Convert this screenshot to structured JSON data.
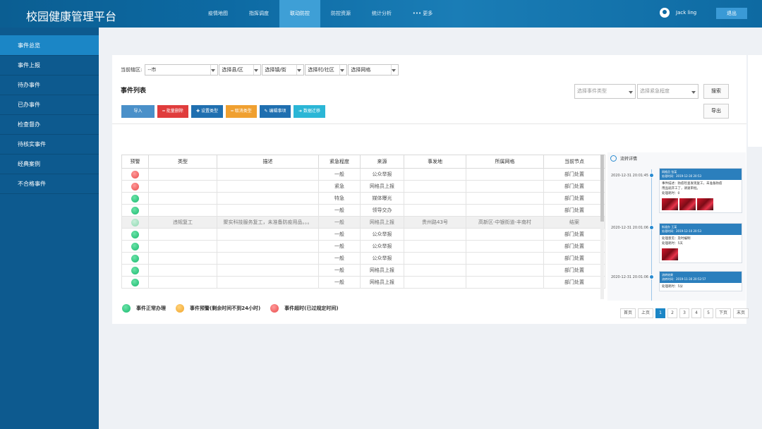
{
  "app": {
    "title": "校园健康管理平台"
  },
  "nav": [
    {
      "label": "疫情地图",
      "active": false
    },
    {
      "label": "指挥调度",
      "active": false
    },
    {
      "label": "联动防控",
      "active": true
    },
    {
      "label": "防控资源",
      "active": false
    },
    {
      "label": "统计分析",
      "active": false
    },
    {
      "label": "••• 更多",
      "active": false
    }
  ],
  "user": {
    "name": "Jack ling",
    "logout": "退出"
  },
  "sidebar": {
    "items": [
      {
        "label": "事件总览",
        "active": true
      },
      {
        "label": "事件上报"
      },
      {
        "label": "待办事件"
      },
      {
        "label": "已办事件"
      },
      {
        "label": "检查督办"
      },
      {
        "label": "待核实事件"
      },
      {
        "label": "经典案例"
      },
      {
        "label": "不合格事件"
      }
    ]
  },
  "filters": {
    "label": "当前辖区:",
    "selects": [
      "--市",
      "选择县/区",
      "选择镇/街",
      "选择村/社区",
      "选择网格"
    ]
  },
  "list": {
    "title": "事件列表",
    "event_type_placeholder": "选择事件类型",
    "urgency_placeholder": "选择紧急程度",
    "search": "搜索",
    "export": "导出"
  },
  "actions": [
    {
      "label": "导入",
      "color": "#4a90c9"
    },
    {
      "label": "━ 批量删除",
      "color": "#e03c3c"
    },
    {
      "label": "✚ 设置类型",
      "color": "#1f6fb0"
    },
    {
      "label": "━ 取消类型",
      "color": "#f0a030"
    },
    {
      "label": "✎ 编辑事项",
      "color": "#1f6fb0"
    },
    {
      "label": "➜ 数据迁移",
      "color": "#2bb6d6"
    }
  ],
  "table": {
    "headers": [
      "预警",
      "类型",
      "描述",
      "紧急程度",
      "来源",
      "事发地",
      "所属网格",
      "当前节点"
    ],
    "rows": [
      {
        "status": "red",
        "type": "",
        "desc": "",
        "urgency": "一般",
        "source": "公众举报",
        "place": "",
        "grid": "",
        "node": "部门处置",
        "highlight": false
      },
      {
        "status": "red",
        "type": "",
        "desc": "",
        "urgency": "紧急",
        "source": "网格员上报",
        "place": "",
        "grid": "",
        "node": "部门处置",
        "highlight": false
      },
      {
        "status": "green",
        "type": "",
        "desc": "",
        "urgency": "特急",
        "source": "媒体曝光",
        "place": "",
        "grid": "",
        "node": "部门处置",
        "highlight": false
      },
      {
        "status": "green",
        "type": "",
        "desc": "",
        "urgency": "一般",
        "source": "领导交办",
        "place": "",
        "grid": "",
        "node": "部门处置",
        "highlight": false
      },
      {
        "status": "pale",
        "type": "违规复工",
        "desc": "聚实科技服务复工，未准备防疫用品。。。",
        "urgency": "一般",
        "source": "网格员上报",
        "place": "贵州路43号",
        "grid": "高新区-中银街道-丰南村",
        "node": "结案",
        "highlight": true
      },
      {
        "status": "green",
        "type": "",
        "desc": "",
        "urgency": "一般",
        "source": "公众举报",
        "place": "",
        "grid": "",
        "node": "部门处置",
        "highlight": false
      },
      {
        "status": "green",
        "type": "",
        "desc": "",
        "urgency": "一般",
        "source": "公众举报",
        "place": "",
        "grid": "",
        "node": "部门处置",
        "highlight": false
      },
      {
        "status": "green",
        "type": "",
        "desc": "",
        "urgency": "一般",
        "source": "公众举报",
        "place": "",
        "grid": "",
        "node": "部门处置",
        "highlight": false
      },
      {
        "status": "green",
        "type": "",
        "desc": "",
        "urgency": "一般",
        "source": "网格员上报",
        "place": "",
        "grid": "",
        "node": "部门处置",
        "highlight": false
      },
      {
        "status": "green",
        "type": "",
        "desc": "",
        "urgency": "一般",
        "source": "网格员上报",
        "place": "",
        "grid": "",
        "node": "部门处置",
        "highlight": false
      }
    ]
  },
  "legend": [
    {
      "color": "green",
      "label": "事件正常办理"
    },
    {
      "color": "orange",
      "label": "事件预警(剩余时间不到24小时)"
    },
    {
      "color": "red",
      "label": "事件超时(已过规定时间)"
    }
  ],
  "pager": [
    "首页",
    "上页",
    "1",
    "2",
    "3",
    "4",
    "5",
    "下页",
    "末页"
  ],
  "pager_current": "1",
  "timeline": {
    "title": "流转详情",
    "entries": [
      {
        "time": "2020-12-31 20:01:45",
        "header": "网格员 张某",
        "sub": "处理时间：2019-12-30 20:53",
        "lines": [
          "事件描述：防疫检查发现复工，未准备防疫",
          "用品就开工了，请速审批。",
          "处理耗时：0"
        ],
        "photos": 3
      },
      {
        "time": "2020-12-31 20:01:06",
        "header": "街道办 王某",
        "sub": "处理时间：2019-12-10 20:53",
        "lines": [
          "处理意见：及时编制",
          "处理耗时：5天"
        ],
        "photos": 1
      },
      {
        "time": "2020-12-31 20:01:06",
        "header": "流转结果",
        "sub": "流转时间：2019-11-30 20:52:57",
        "lines": [
          "处理耗时：5分"
        ],
        "photos": 0
      }
    ]
  }
}
